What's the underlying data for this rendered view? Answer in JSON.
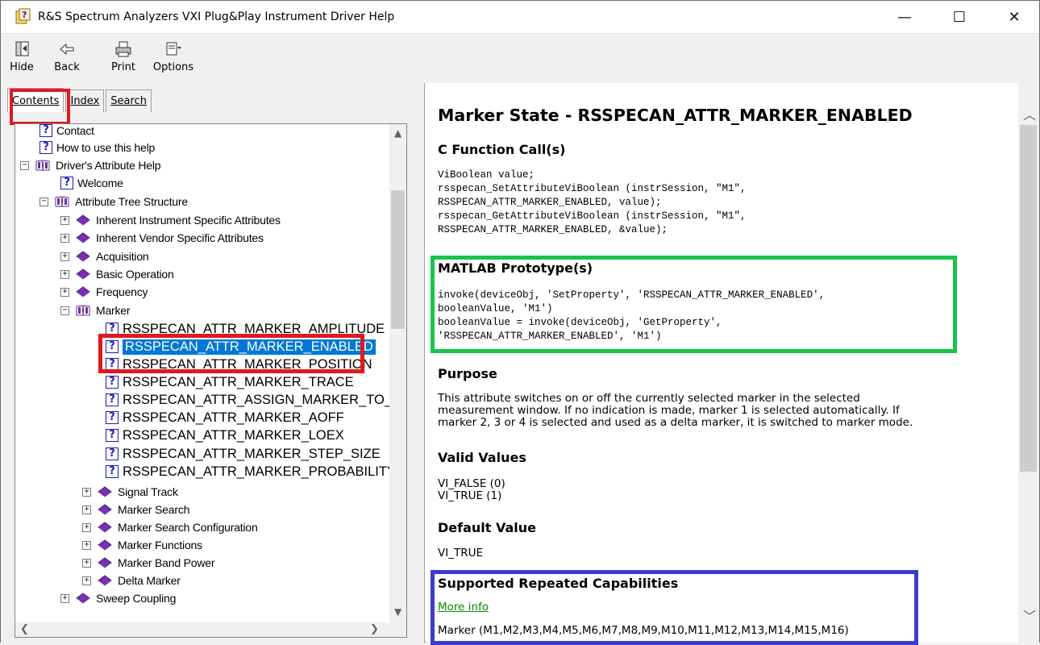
{
  "window": {
    "title": "R&S Spectrum Analyzers VXI Plug&Play Instrument Driver Help",
    "minimize": "—",
    "maximize": "☐",
    "close": "✕"
  },
  "toolbar": {
    "hide": "Hide",
    "back": "Back",
    "print": "Print",
    "options": "Options"
  },
  "tabs": {
    "contents": "Contents",
    "index": "Index",
    "search": "Search"
  },
  "tree": [
    {
      "label": "Contact",
      "icon": "help-page-icon"
    },
    {
      "label": "How to use this help",
      "icon": "help-page-icon"
    },
    {
      "label": "Driver's Attribute Help",
      "icon": "open-book-icon",
      "expander": "−"
    },
    {
      "label": "Welcome",
      "icon": "help-page-icon"
    },
    {
      "label": "Attribute Tree Structure",
      "icon": "open-book-icon",
      "expander": "−"
    },
    {
      "label": "Inherent Instrument Specific Attributes",
      "icon": "closed-book-icon",
      "expander": "+"
    },
    {
      "label": "Inherent Vendor Specific Attributes",
      "icon": "closed-book-icon",
      "expander": "+"
    },
    {
      "label": "Acquisition",
      "icon": "closed-book-icon",
      "expander": "+"
    },
    {
      "label": "Basic Operation",
      "icon": "closed-book-icon",
      "expander": "+"
    },
    {
      "label": "Frequency",
      "icon": "closed-book-icon",
      "expander": "+"
    },
    {
      "label": "Marker",
      "icon": "open-book-icon",
      "expander": "−"
    },
    {
      "label": "RSSPECAN_ATTR_MARKER_AMPLITUDE",
      "icon": "help-page-icon"
    },
    {
      "label": "RSSPECAN_ATTR_MARKER_ENABLED",
      "icon": "help-page-icon",
      "selected": true
    },
    {
      "label": "RSSPECAN_ATTR_MARKER_POSITION",
      "icon": "help-page-icon"
    },
    {
      "label": "RSSPECAN_ATTR_MARKER_TRACE",
      "icon": "help-page-icon"
    },
    {
      "label": "RSSPECAN_ATTR_ASSIGN_MARKER_TO_T",
      "icon": "help-page-icon"
    },
    {
      "label": "RSSPECAN_ATTR_MARKER_AOFF",
      "icon": "help-page-icon"
    },
    {
      "label": "RSSPECAN_ATTR_MARKER_LOEX",
      "icon": "help-page-icon"
    },
    {
      "label": "RSSPECAN_ATTR_MARKER_STEP_SIZE",
      "icon": "help-page-icon"
    },
    {
      "label": "RSSPECAN_ATTR_MARKER_PROBABILITY",
      "icon": "help-page-icon"
    },
    {
      "label": "Signal Track",
      "icon": "closed-book-icon",
      "expander": "+"
    },
    {
      "label": "Marker Search",
      "icon": "closed-book-icon",
      "expander": "+"
    },
    {
      "label": "Marker Search Configuration",
      "icon": "closed-book-icon",
      "expander": "+"
    },
    {
      "label": "Marker Functions",
      "icon": "closed-book-icon",
      "expander": "+"
    },
    {
      "label": "Marker Band Power",
      "icon": "closed-book-icon",
      "expander": "+"
    },
    {
      "label": "Delta Marker",
      "icon": "closed-book-icon",
      "expander": "+"
    },
    {
      "label": "Sweep Coupling",
      "icon": "closed-book-icon",
      "expander": "+"
    }
  ],
  "doc": {
    "title": "Marker State - RSSPECAN_ATTR_MARKER_ENABLED",
    "c_heading": "C Function Call(s)",
    "c_code": "ViBoolean value;\nrsspecan_SetAttributeViBoolean (instrSession, \"M1\",\nRSSPECAN_ATTR_MARKER_ENABLED, value);\nrsspecan_GetAttributeViBoolean (instrSession, \"M1\",\nRSSPECAN_ATTR_MARKER_ENABLED, &value);",
    "matlab_heading": "MATLAB Prototype(s)",
    "matlab_code": "invoke(deviceObj, 'SetProperty', 'RSSPECAN_ATTR_MARKER_ENABLED',\nbooleanValue, 'M1')\nbooleanValue = invoke(deviceObj, 'GetProperty',\n'RSSPECAN_ATTR_MARKER_ENABLED', 'M1')",
    "purpose_heading": "Purpose",
    "purpose_lines": [
      "This attribute switches on or off the currently selected marker in the selected",
      "measurement window. If no indication is made, marker 1 is selected automatically. If",
      "marker 2, 3 or 4 is selected and used as a delta marker, it is switched to marker mode."
    ],
    "valid_heading": "Valid Values",
    "valid_values": [
      "VI_FALSE (0)",
      "VI_TRUE (1)"
    ],
    "default_heading": "Default Value",
    "default_value": "VI_TRUE",
    "rc_heading": "Supported Repeated Capabilities",
    "rc_link": "More info",
    "rc_value": "Marker (M1,M2,M3,M4,M5,M6,M7,M8,M9,M10,M11,M12,M13,M14,M15,M16)"
  },
  "colors": {
    "highlight_red": "#e0191e",
    "highlight_green": "#19c34a",
    "highlight_blue": "#3b3bd1",
    "selection_blue": "#0078d7",
    "link_green": "#0a8a0a"
  }
}
